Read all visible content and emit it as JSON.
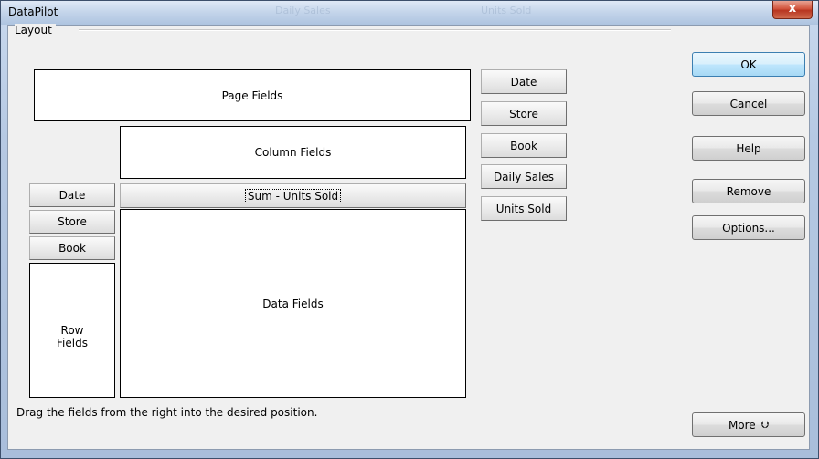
{
  "window": {
    "title": "DataPilot",
    "close_label": "x",
    "background_title_ghosts": [
      "Daily Sales",
      "Units Sold"
    ]
  },
  "layout": {
    "group_label": "Layout",
    "page_fields": "Page Fields",
    "column_fields": "Column Fields",
    "row_fields_line1": "Row",
    "row_fields_line2": "Fields",
    "data_fields": "Data Fields",
    "data_field_item": "Sum - Units Sold",
    "row_field_items": [
      "Date",
      "Store",
      "Book"
    ]
  },
  "available_fields": [
    "Date",
    "Store",
    "Book",
    "Daily Sales",
    "Units Sold"
  ],
  "buttons": {
    "ok": "OK",
    "cancel": "Cancel",
    "help": "Help",
    "remove": "Remove",
    "options": "Options...",
    "more": "More"
  },
  "hint": "Drag the fields from the right into the desired position."
}
